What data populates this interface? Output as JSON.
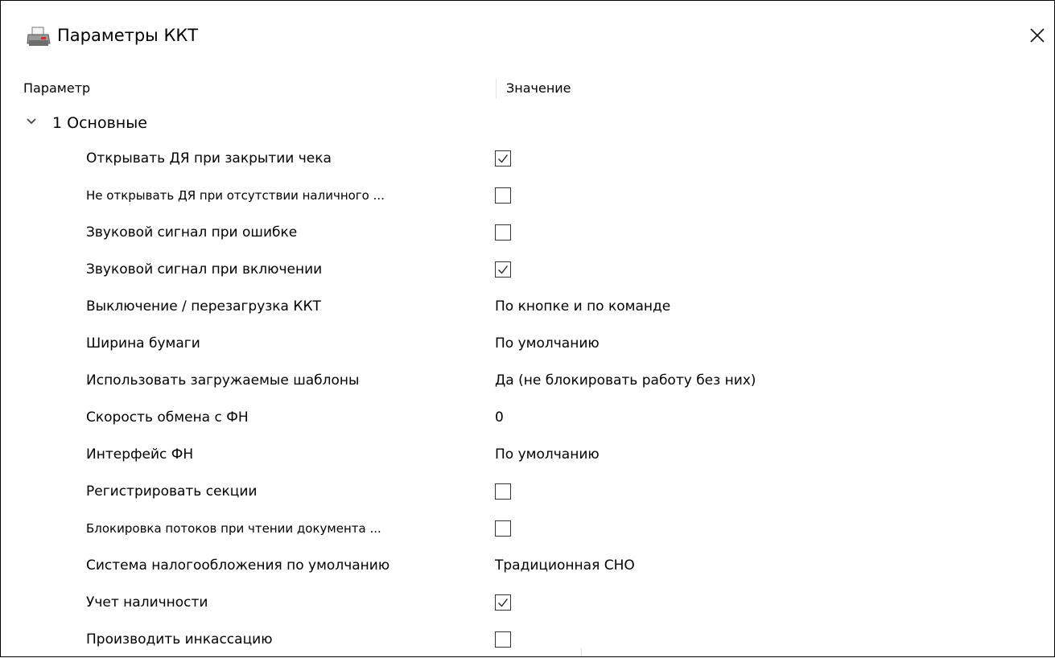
{
  "window": {
    "title": "Параметры ККТ",
    "app_icon": "printer-icon",
    "close_icon": "close-icon"
  },
  "columns": {
    "param": "Параметр",
    "value": "Значение"
  },
  "group": {
    "label": "1 Основные",
    "expanded": true,
    "icon": "chevron-down-icon"
  },
  "rows": [
    {
      "name": "Открывать ДЯ при закрытии чека",
      "type": "checkbox",
      "checked": true
    },
    {
      "name": "Не открывать ДЯ при отсутствии наличного ...",
      "type": "checkbox",
      "checked": false,
      "small": true
    },
    {
      "name": "Звуковой сигнал при ошибке",
      "type": "checkbox",
      "checked": false
    },
    {
      "name": "Звуковой сигнал при включении",
      "type": "checkbox",
      "checked": true
    },
    {
      "name": "Выключение / перезагрузка ККТ",
      "type": "text",
      "value": "По кнопке и по команде"
    },
    {
      "name": "Ширина бумаги",
      "type": "text",
      "value": "По умолчанию"
    },
    {
      "name": "Использовать загружаемые шаблоны",
      "type": "text",
      "value": "Да (не блокировать работу без них)"
    },
    {
      "name": "Скорость обмена с ФН",
      "type": "text",
      "value": "0"
    },
    {
      "name": "Интерфейс ФН",
      "type": "text",
      "value": "По умолчанию"
    },
    {
      "name": "Регистрировать секции",
      "type": "checkbox",
      "checked": false
    },
    {
      "name": "Блокировка потоков при чтении документа ...",
      "type": "checkbox",
      "checked": false,
      "small": true
    },
    {
      "name": "Система налогообложения по умолчанию",
      "type": "text",
      "value": "Традиционная СНО"
    },
    {
      "name": "Учет наличности",
      "type": "checkbox",
      "checked": true
    },
    {
      "name": "Производить инкассацию",
      "type": "checkbox",
      "checked": false
    }
  ]
}
